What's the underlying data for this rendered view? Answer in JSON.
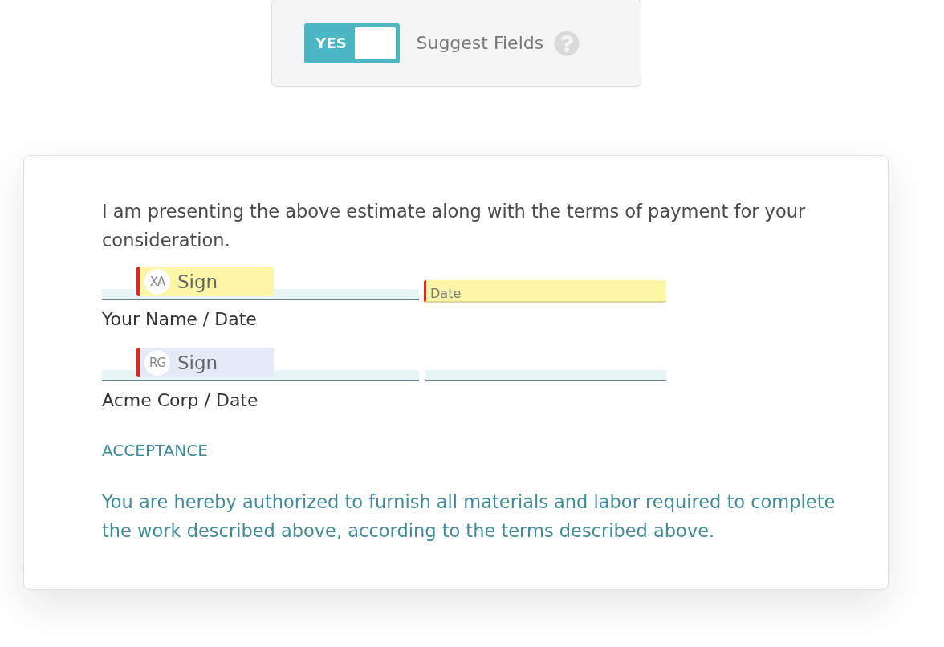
{
  "suggest_fields": {
    "toggle": {
      "text": "YES",
      "on": true
    },
    "label": "Suggest Fields"
  },
  "document": {
    "intro": "I am presenting the above estimate along with the terms of payment for your consideration.",
    "signature_rows": [
      {
        "signature": {
          "initials": "XA",
          "label": "Sign",
          "color": "#fcf6a6",
          "required": true
        },
        "date_field": {
          "placeholder": "Date",
          "color": "#fcf6a6",
          "required": true
        },
        "caption": "Your Name / Date"
      },
      {
        "signature": {
          "initials": "RG",
          "label": "Sign",
          "color": "#e5eaf8",
          "required": true
        },
        "caption": "Acme Corp / Date"
      }
    ],
    "heading": "ACCEPTANCE",
    "acceptance": "You are hereby authorized to furnish all materials and labor required to complete the work described above, according to the terms described above."
  }
}
